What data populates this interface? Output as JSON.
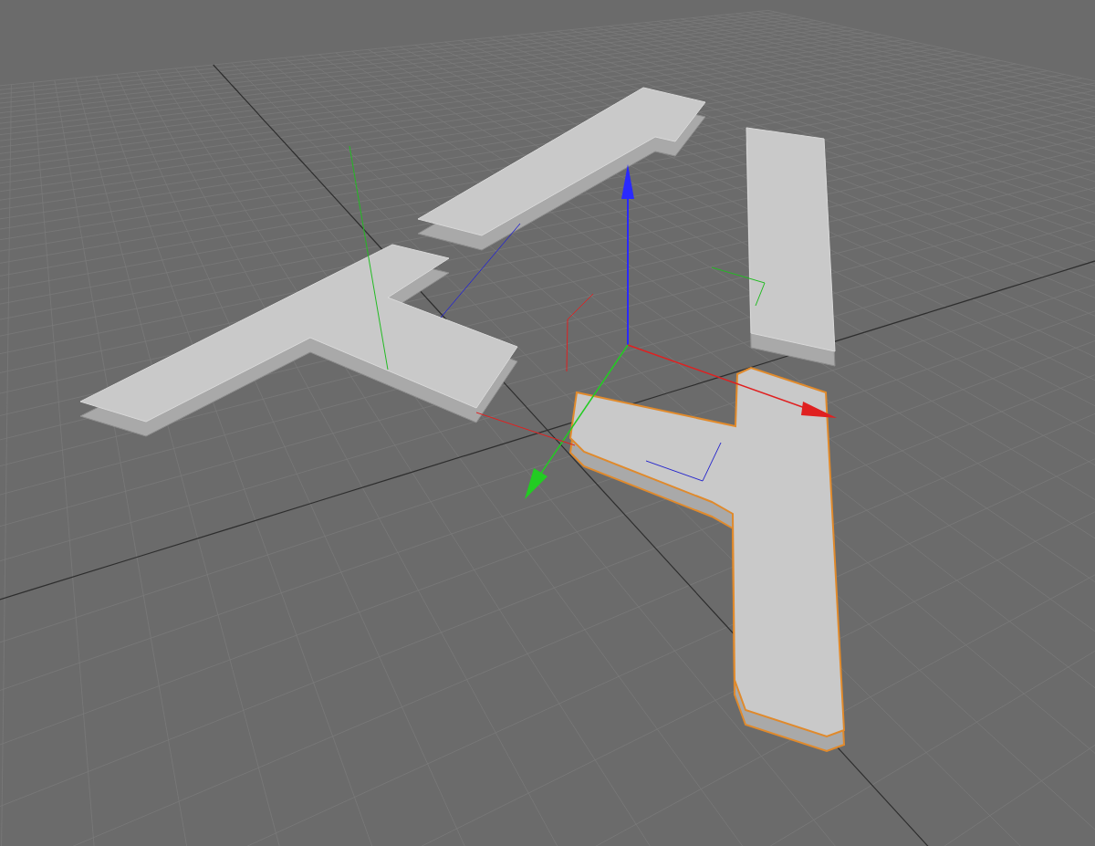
{
  "viewport": {
    "objects": [
      {
        "selected": false
      },
      {
        "selected": false
      },
      {
        "selected": false
      },
      {
        "selected": true
      }
    ]
  }
}
